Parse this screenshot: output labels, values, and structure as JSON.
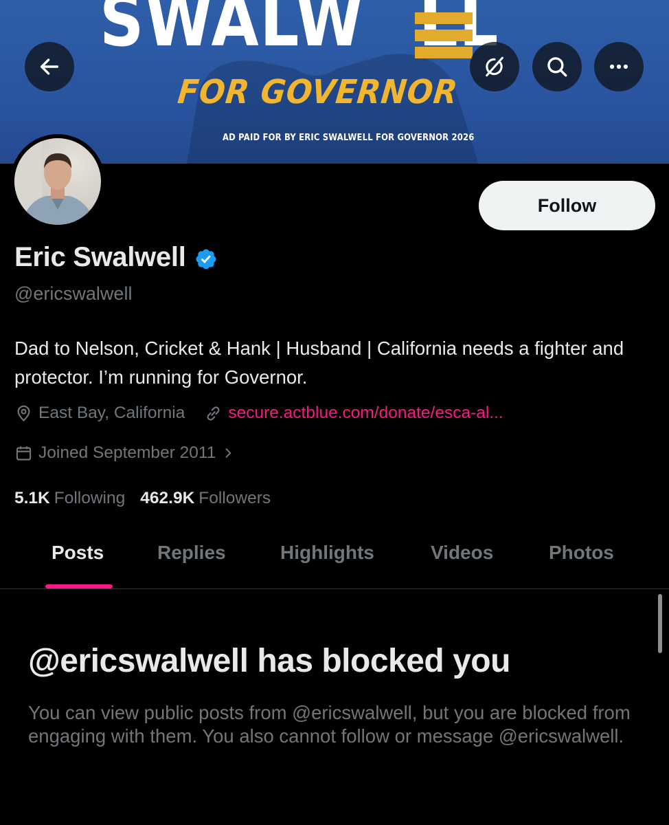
{
  "banner": {
    "title": "SWALW",
    "title_tail": "LL",
    "subtitle": "FOR GOVERNOR",
    "disclaimer": "AD PAID FOR BY ERIC SWALWELL FOR GOVERNOR 2026",
    "colors": {
      "blue": "#2a55a0",
      "gold": "#e3ab2c"
    }
  },
  "nav": {
    "back_icon": "arrow-left-icon",
    "grok_icon": "grok-slash-icon",
    "search_icon": "search-icon",
    "more_icon": "more-dots-icon"
  },
  "profile": {
    "display_name": "Eric Swalwell",
    "handle": "@ericswalwell",
    "bio": "Dad to Nelson, Cricket & Hank | Husband | California needs a fighter and protector. I’m running for Governor.",
    "location": "East Bay, California",
    "website": "secure.actblue.com/donate/esca-al...",
    "joined": "Joined September 2011",
    "following_count": "5.1K",
    "following_label": "Following",
    "followers_count": "462.9K",
    "followers_label": "Followers",
    "follow_label": "Follow"
  },
  "tabs": [
    {
      "label": "Posts",
      "active": true
    },
    {
      "label": "Replies",
      "active": false
    },
    {
      "label": "Highlights",
      "active": false
    },
    {
      "label": "Videos",
      "active": false
    },
    {
      "label": "Photos",
      "active": false
    }
  ],
  "blocked": {
    "title": "@ericswalwell has blocked you",
    "text": "You can view public posts from @ericswalwell, but you are blocked from engaging with them. You also cannot follow or message @ericswalwell."
  },
  "colors": {
    "accent": "#f91880",
    "verified": "#1d9bf0",
    "muted": "#71767b",
    "text": "#e7e9ea"
  }
}
